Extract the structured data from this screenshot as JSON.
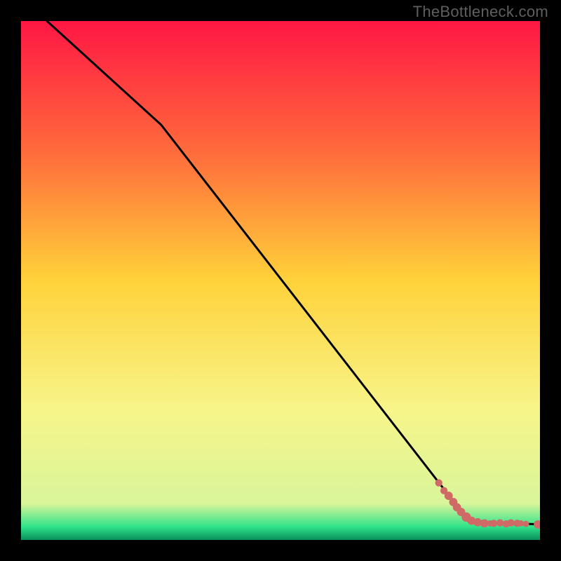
{
  "watermark": "TheBottleneck.com",
  "colors": {
    "background": "#000000",
    "line": "#000000",
    "marker": "#cf6a67",
    "gradient_stops": [
      {
        "offset": 0.0,
        "color": "#ff1744"
      },
      {
        "offset": 0.25,
        "color": "#ff6a3c"
      },
      {
        "offset": 0.5,
        "color": "#ffd23a"
      },
      {
        "offset": 0.75,
        "color": "#f7f58a"
      },
      {
        "offset": 0.93,
        "color": "#d9f59a"
      },
      {
        "offset": 0.975,
        "color": "#2fe28a"
      },
      {
        "offset": 1.0,
        "color": "#0a8f5a"
      }
    ]
  },
  "chart_data": {
    "type": "line",
    "title": "",
    "xlabel": "",
    "ylabel": "",
    "xlim": [
      0,
      100
    ],
    "ylim": [
      0,
      100
    ],
    "series": [
      {
        "name": "bottleneck-curve",
        "x": [
          0,
          5,
          27,
          82.5,
          86.5,
          100
        ],
        "values": [
          108,
          100,
          80,
          8.5,
          3.5,
          3
        ]
      }
    ],
    "markers": {
      "name": "sample-points",
      "points": [
        {
          "x": 80.5,
          "y": 11.0,
          "r": 0.7
        },
        {
          "x": 81.5,
          "y": 9.5,
          "r": 0.7
        },
        {
          "x": 82.4,
          "y": 8.5,
          "r": 0.8
        },
        {
          "x": 83.3,
          "y": 7.3,
          "r": 0.8
        },
        {
          "x": 84.0,
          "y": 6.3,
          "r": 0.8
        },
        {
          "x": 84.8,
          "y": 5.4,
          "r": 0.8
        },
        {
          "x": 85.8,
          "y": 4.4,
          "r": 0.9
        },
        {
          "x": 86.8,
          "y": 3.7,
          "r": 0.8
        },
        {
          "x": 88.0,
          "y": 3.4,
          "r": 0.8
        },
        {
          "x": 89.3,
          "y": 3.2,
          "r": 0.8
        },
        {
          "x": 90.4,
          "y": 3.2,
          "r": 0.6
        },
        {
          "x": 91.1,
          "y": 3.2,
          "r": 0.7
        },
        {
          "x": 92.3,
          "y": 3.3,
          "r": 0.7
        },
        {
          "x": 93.5,
          "y": 3.1,
          "r": 0.7
        },
        {
          "x": 94.4,
          "y": 3.3,
          "r": 0.7
        },
        {
          "x": 95.6,
          "y": 3.2,
          "r": 0.7
        },
        {
          "x": 96.3,
          "y": 3.2,
          "r": 0.6
        },
        {
          "x": 97.3,
          "y": 3.1,
          "r": 0.6
        },
        {
          "x": 99.6,
          "y": 3.0,
          "r": 0.8
        }
      ]
    }
  }
}
